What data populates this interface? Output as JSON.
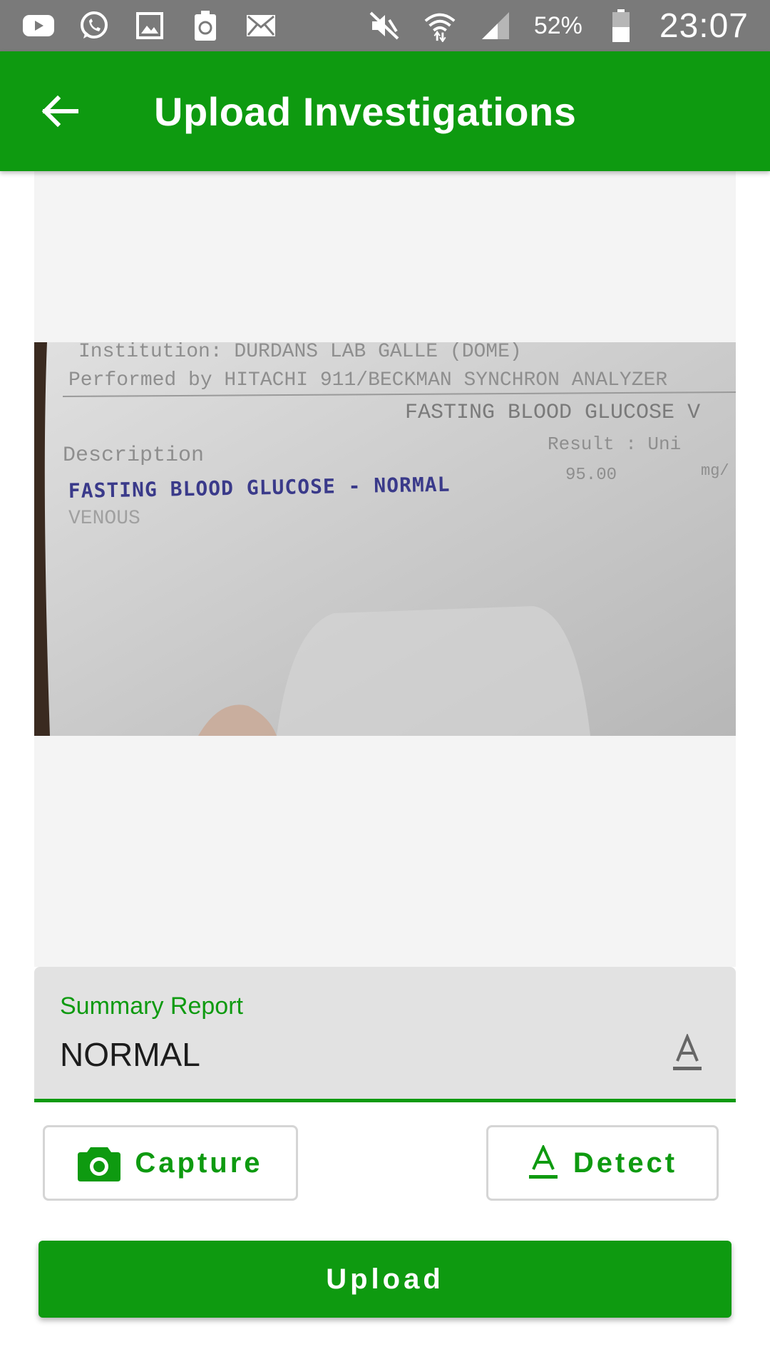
{
  "status_bar": {
    "left_icons": [
      "youtube-icon",
      "whatsapp-icon",
      "gallery-icon",
      "recycle-icon",
      "mail-icon"
    ],
    "right_icons": [
      "mute-icon",
      "wifi-icon",
      "signal-icon"
    ],
    "battery": "52%",
    "time": "23:07"
  },
  "app_bar": {
    "title": "Upload Investigations",
    "back_icon": "arrow-back-icon",
    "color": "#0e9a10"
  },
  "photo": {
    "lines": [
      "Institution: DURDANS LAB GALLE (DOME)",
      "Performed by HITACHI 911/BECKMAN SYNCHRON ANALYZER",
      "FASTING BLOOD GLUCOSE V",
      "Result :    Uni",
      "Description",
      "FASTING BLOOD GLUCOSE  - NORMAL",
      "95.00",
      "mg/",
      "VENOUS"
    ]
  },
  "summary": {
    "label": "Summary Report",
    "value": "NORMAL",
    "icon": "text-format-icon"
  },
  "buttons": {
    "capture_label": "Capture",
    "capture_icon": "camera-icon",
    "detect_label": "Detect",
    "detect_icon": "text-format-icon",
    "upload_label": "Upload"
  },
  "colors": {
    "accent": "#0e9a10",
    "status_bar": "#7a7a7a"
  }
}
